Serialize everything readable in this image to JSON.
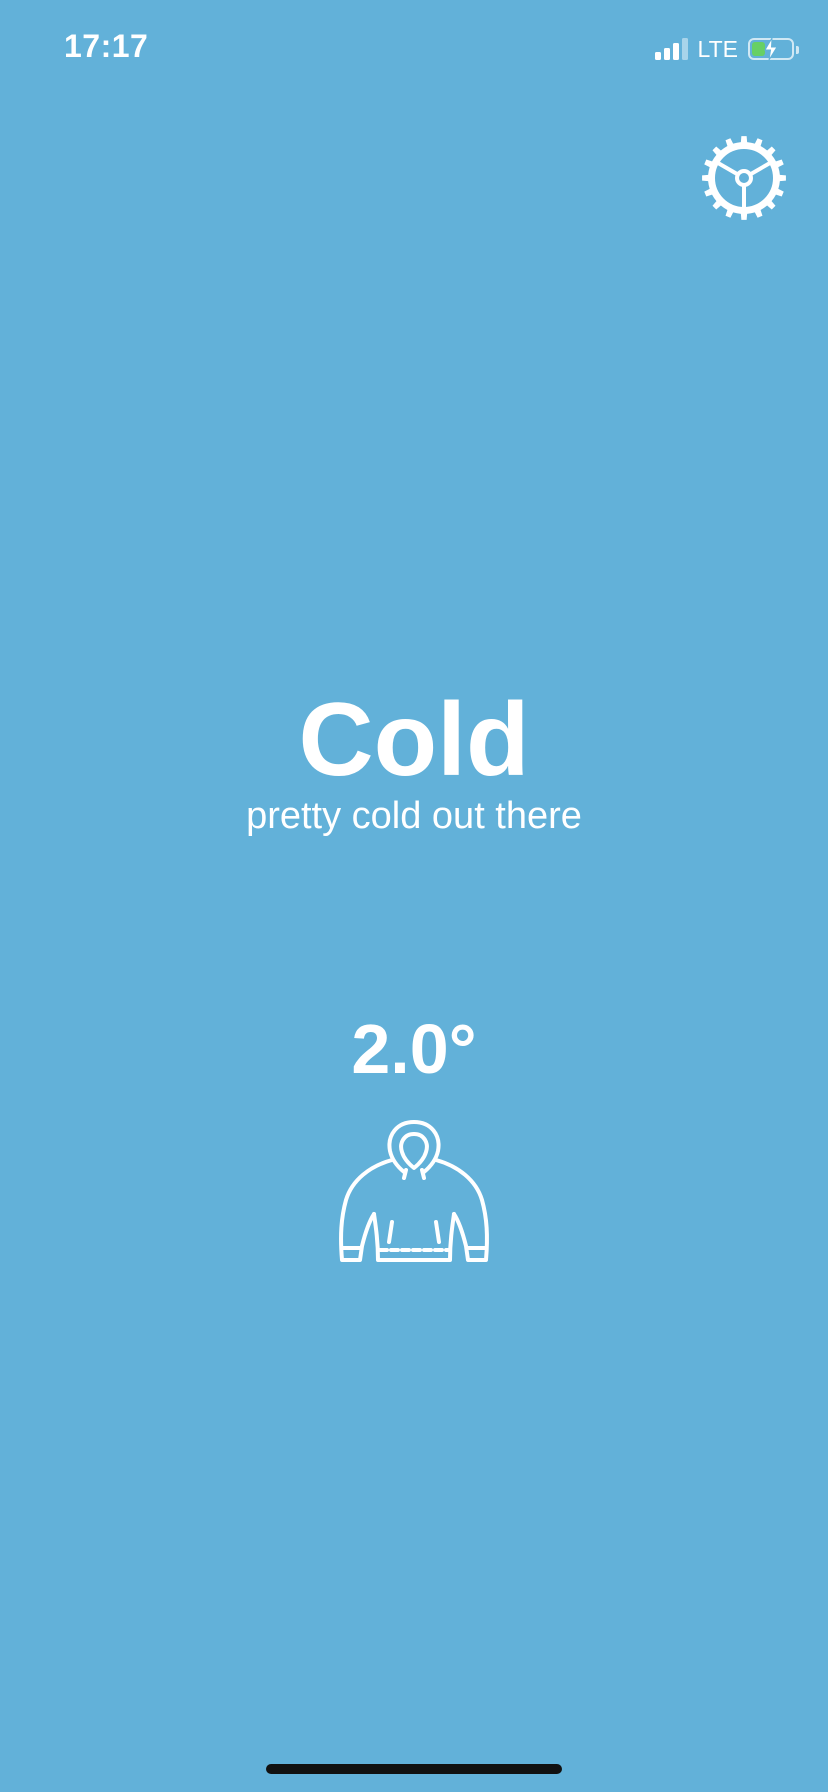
{
  "status_bar": {
    "time": "17:17",
    "network": "LTE",
    "signal_bars_active": 3,
    "signal_bars_total": 4,
    "battery_level": 0.35,
    "battery_charging": true
  },
  "header": {
    "settings_icon": "gear-icon"
  },
  "weather": {
    "condition": "Cold",
    "description": "pretty cold out there",
    "temperature": "2.0°",
    "clothing_icon": "hoodie-icon"
  },
  "colors": {
    "background": "#62B1D9",
    "foreground": "#FFFFFF",
    "battery_fill": "#67D065"
  }
}
